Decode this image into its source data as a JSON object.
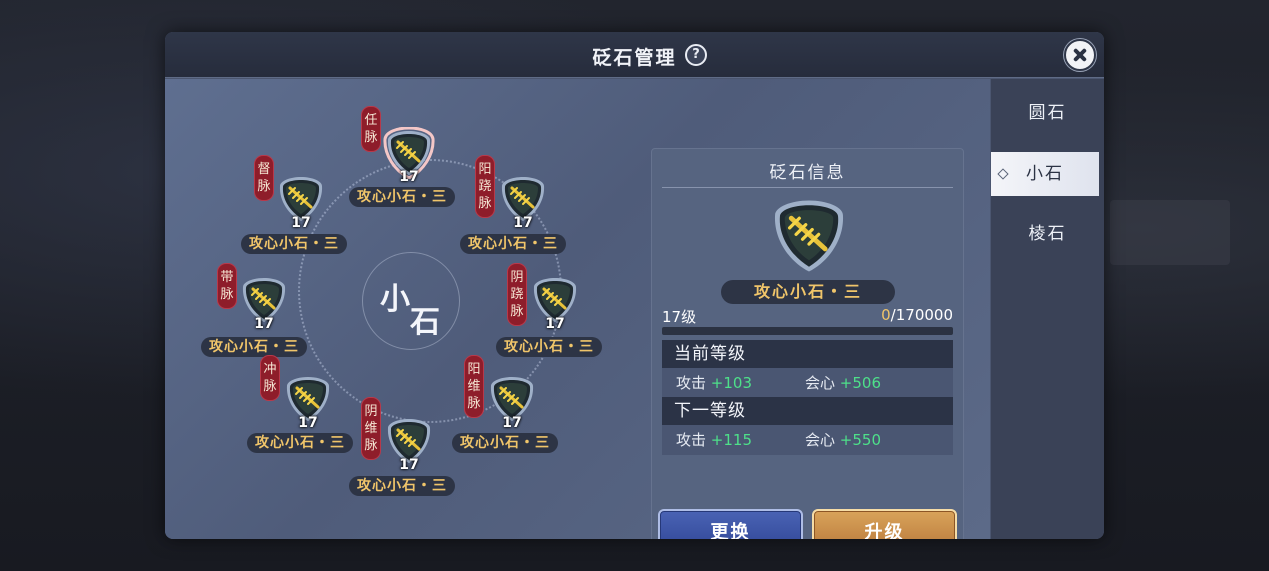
{
  "dialog": {
    "title": "砭石管理",
    "help_icon": "question-icon",
    "close_icon": "close-icon"
  },
  "sidebar": {
    "tabs": [
      {
        "label": "圆石",
        "active": false
      },
      {
        "label": "小石",
        "active": true
      },
      {
        "label": "棱石",
        "active": false
      }
    ]
  },
  "wheel": {
    "center_label_1": "小",
    "center_label_2": "石",
    "slots": [
      {
        "meridian": "任脉",
        "level": "17",
        "name": "攻心小石・三",
        "selected": true
      },
      {
        "meridian": "督脉",
        "level": "17",
        "name": "攻心小石・三",
        "selected": false
      },
      {
        "meridian": "阳跷脉",
        "level": "17",
        "name": "攻心小石・三",
        "selected": false
      },
      {
        "meridian": "带脉",
        "level": "17",
        "name": "攻心小石・三",
        "selected": false
      },
      {
        "meridian": "阴跷脉",
        "level": "17",
        "name": "攻心小石・三",
        "selected": false
      },
      {
        "meridian": "冲脉",
        "level": "17",
        "name": "攻心小石・三",
        "selected": false
      },
      {
        "meridian": "阳维脉",
        "level": "17",
        "name": "攻心小石・三",
        "selected": false
      },
      {
        "meridian": "阴维脉",
        "level": "17",
        "name": "攻心小石・三",
        "selected": false
      }
    ]
  },
  "info": {
    "title": "砭石信息",
    "stone_name": "攻心小石・三",
    "level_label": "17级",
    "exp_current": "0",
    "exp_total": "/170000",
    "exp_fraction": 0,
    "current_header": "当前等级",
    "next_header": "下一等级",
    "current_stats": [
      {
        "label": "攻击",
        "value": "+103"
      },
      {
        "label": "会心",
        "value": "+506"
      }
    ],
    "next_stats": [
      {
        "label": "攻击",
        "value": "+115"
      },
      {
        "label": "会心",
        "value": "+550"
      }
    ],
    "replace_label": "更换",
    "upgrade_label": "升级"
  },
  "colors": {
    "gem_name_text": "#f0c56a",
    "meridian_tag": "#8e1d2a",
    "stat_value": "#4ee08a",
    "replace_button": "#3b52a4",
    "upgrade_button": "#c88a48"
  }
}
